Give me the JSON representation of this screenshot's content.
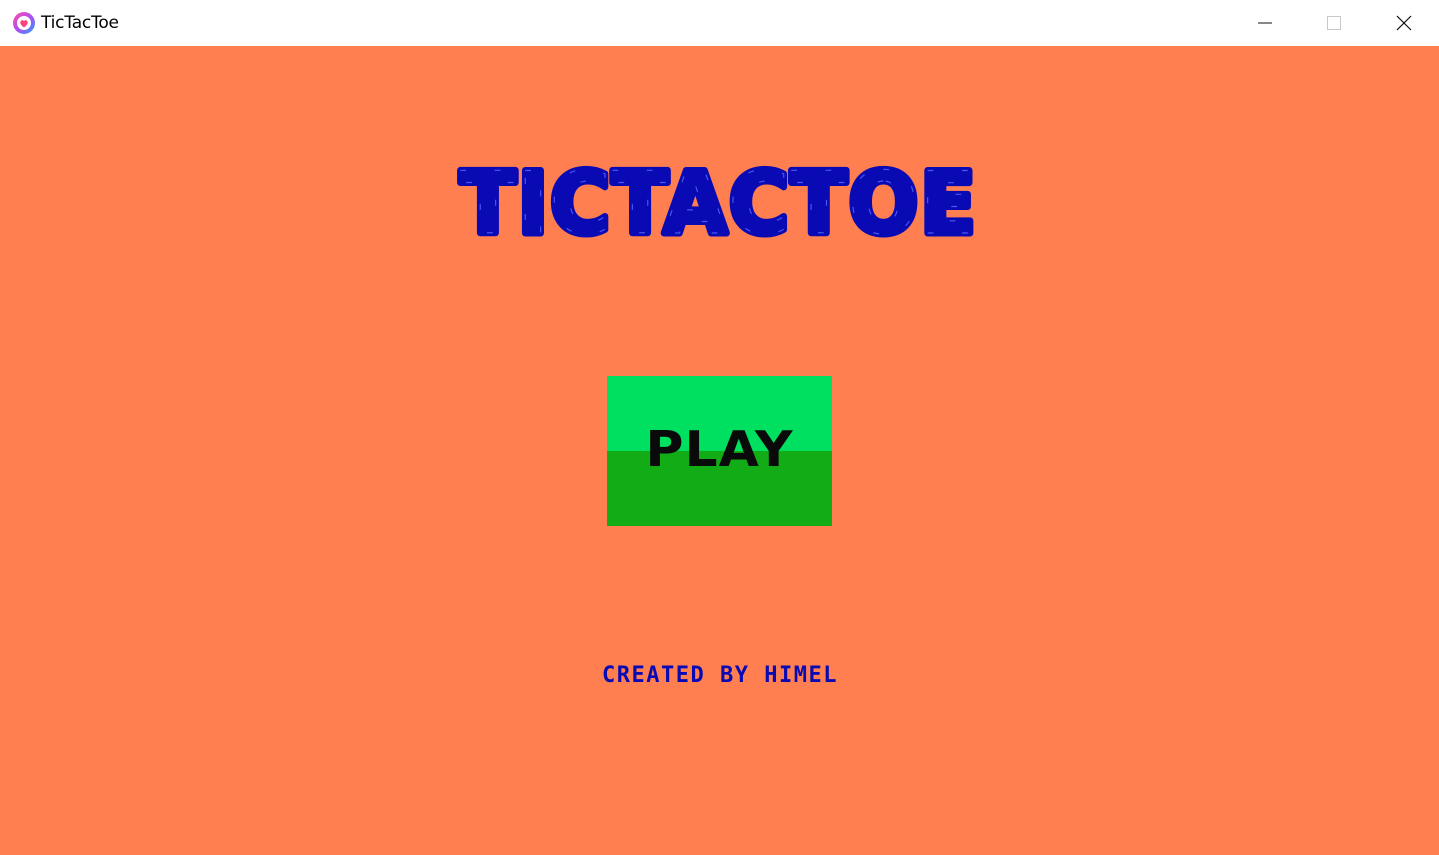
{
  "window": {
    "title": "TicTacToe",
    "icons": {
      "app": "app-logo-icon",
      "minimize": "minimize-icon",
      "maximize": "maximize-icon",
      "close": "close-icon"
    }
  },
  "menu": {
    "title": "TICTACTOE",
    "play_label": "PLAY",
    "credits": "CREATED BY HIMEL"
  },
  "colors": {
    "background": "#ff7f50",
    "title": "#0a0ab4",
    "play_top": "#00e060",
    "play_bottom": "#12ac17",
    "play_text": "#0a0a0a",
    "credits": "#0a0ab4"
  }
}
